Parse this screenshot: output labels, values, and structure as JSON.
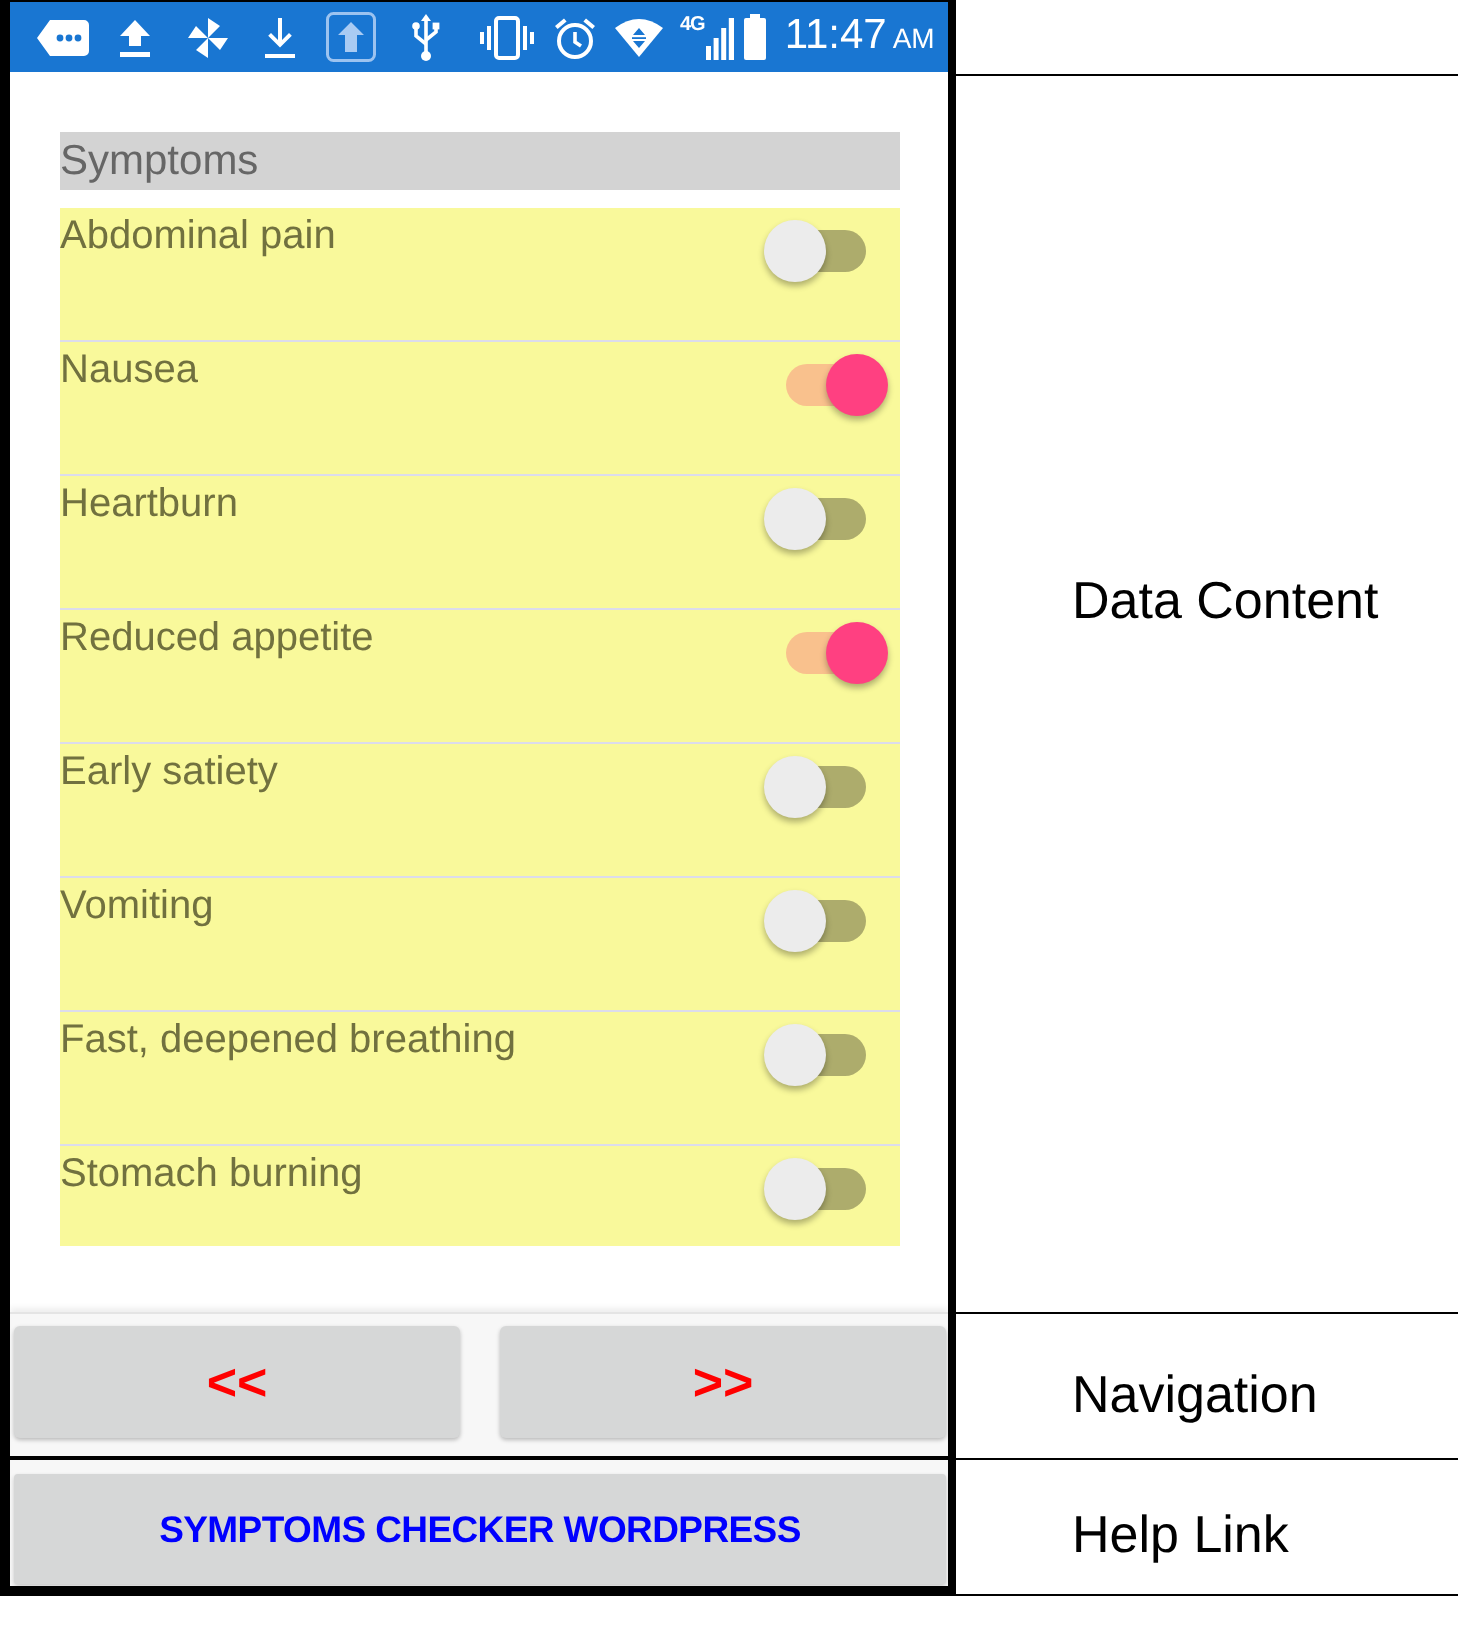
{
  "status_bar": {
    "network": "4G",
    "time": "11:47",
    "period": "AM"
  },
  "section": {
    "title": "Symptoms"
  },
  "symptoms": [
    {
      "label": "Abdominal pain",
      "on": false
    },
    {
      "label": "Nausea",
      "on": true
    },
    {
      "label": "Heartburn",
      "on": false
    },
    {
      "label": "Reduced appetite",
      "on": true
    },
    {
      "label": "Early satiety",
      "on": false
    },
    {
      "label": "Vomiting",
      "on": false
    },
    {
      "label": "Fast, deepened breathing",
      "on": false
    },
    {
      "label": "Stomach burning",
      "on": false
    }
  ],
  "navigation": {
    "buttons": [
      {
        "label": "<<"
      },
      {
        "label": ">>"
      }
    ]
  },
  "help_link": {
    "label": "SYMPTOMS CHECKER WORDPRESS"
  },
  "annotations": [
    {
      "label": "Data Content"
    },
    {
      "label": "Navigation"
    },
    {
      "label": "Help Link"
    }
  ]
}
